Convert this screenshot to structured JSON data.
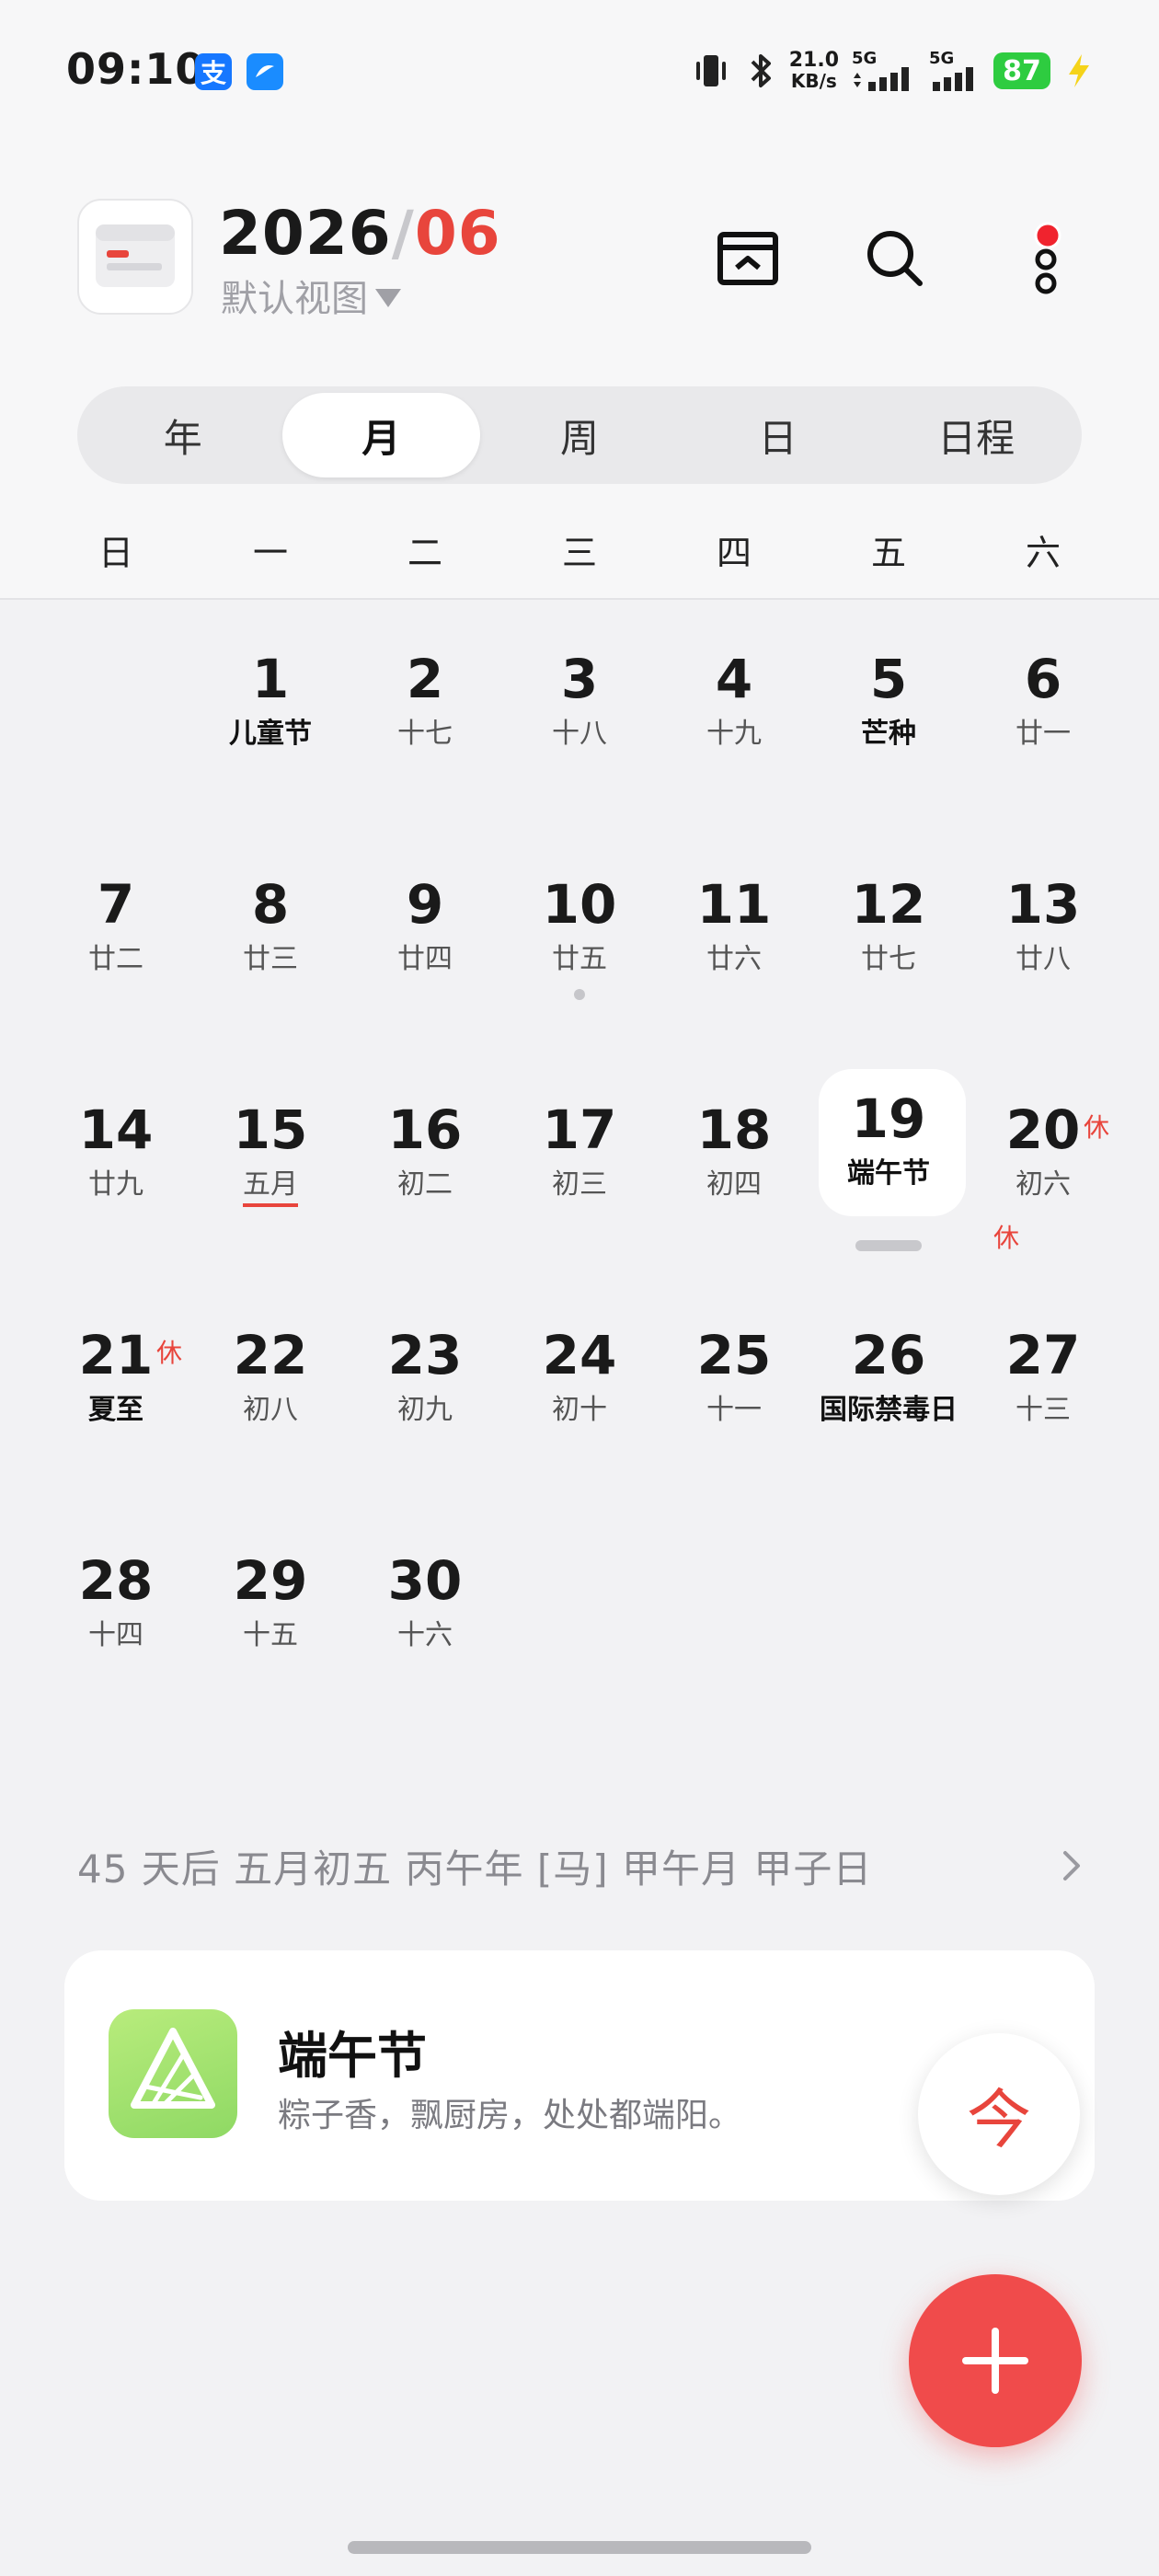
{
  "status_bar": {
    "time": "09:10",
    "app_badges": [
      "支",
      "⌬"
    ],
    "net_speed_value": "21.0",
    "net_speed_unit": "KB/s",
    "signal1_label": "5G",
    "signal2_label": "5G",
    "battery": "87"
  },
  "header": {
    "year": "2026",
    "slash": "/",
    "month": "06",
    "view_label": "默认视图"
  },
  "tabs": [
    {
      "label": "年",
      "active": false
    },
    {
      "label": "月",
      "active": true
    },
    {
      "label": "周",
      "active": false
    },
    {
      "label": "日",
      "active": false
    },
    {
      "label": "日程",
      "active": false
    }
  ],
  "weekdays": [
    "日",
    "一",
    "二",
    "三",
    "四",
    "五",
    "六"
  ],
  "days": [
    {
      "n": "1",
      "s": "儿童节",
      "strong": true
    },
    {
      "n": "2",
      "s": "十七"
    },
    {
      "n": "3",
      "s": "十八"
    },
    {
      "n": "4",
      "s": "十九"
    },
    {
      "n": "5",
      "s": "芒种",
      "strong": true
    },
    {
      "n": "6",
      "s": "廿一"
    },
    {
      "n": "7",
      "s": "廿二"
    },
    {
      "n": "8",
      "s": "廿三"
    },
    {
      "n": "9",
      "s": "廿四"
    },
    {
      "n": "10",
      "s": "廿五",
      "dot": true
    },
    {
      "n": "11",
      "s": "廿六"
    },
    {
      "n": "12",
      "s": "廿七"
    },
    {
      "n": "13",
      "s": "廿八"
    },
    {
      "n": "14",
      "s": "廿九"
    },
    {
      "n": "15",
      "s": "五月",
      "underline": true
    },
    {
      "n": "16",
      "s": "初二"
    },
    {
      "n": "17",
      "s": "初三"
    },
    {
      "n": "18",
      "s": "初四"
    },
    {
      "n": "19",
      "s": "端午节",
      "strong": true,
      "rest": "休",
      "today": true
    },
    {
      "n": "20",
      "s": "初六",
      "rest": "休"
    },
    {
      "n": "21",
      "s": "夏至",
      "strong": true,
      "rest": "休"
    },
    {
      "n": "22",
      "s": "初八"
    },
    {
      "n": "23",
      "s": "初九"
    },
    {
      "n": "24",
      "s": "初十"
    },
    {
      "n": "25",
      "s": "十一"
    },
    {
      "n": "26",
      "s": "国际禁毒日",
      "strong": true
    },
    {
      "n": "27",
      "s": "十三"
    },
    {
      "n": "28",
      "s": "十四"
    },
    {
      "n": "29",
      "s": "十五"
    },
    {
      "n": "30",
      "s": "十六"
    }
  ],
  "lunar_info": "45 天后 五月初五 丙午年 [马] 甲午月 甲子日",
  "festival": {
    "title": "端午节",
    "desc": "粽子香，飘厨房，处处都端阳。"
  },
  "today_button": "今",
  "colors": {
    "accent": "#e8453c",
    "fab": "#f04b4b",
    "battery": "#2ecc40"
  }
}
